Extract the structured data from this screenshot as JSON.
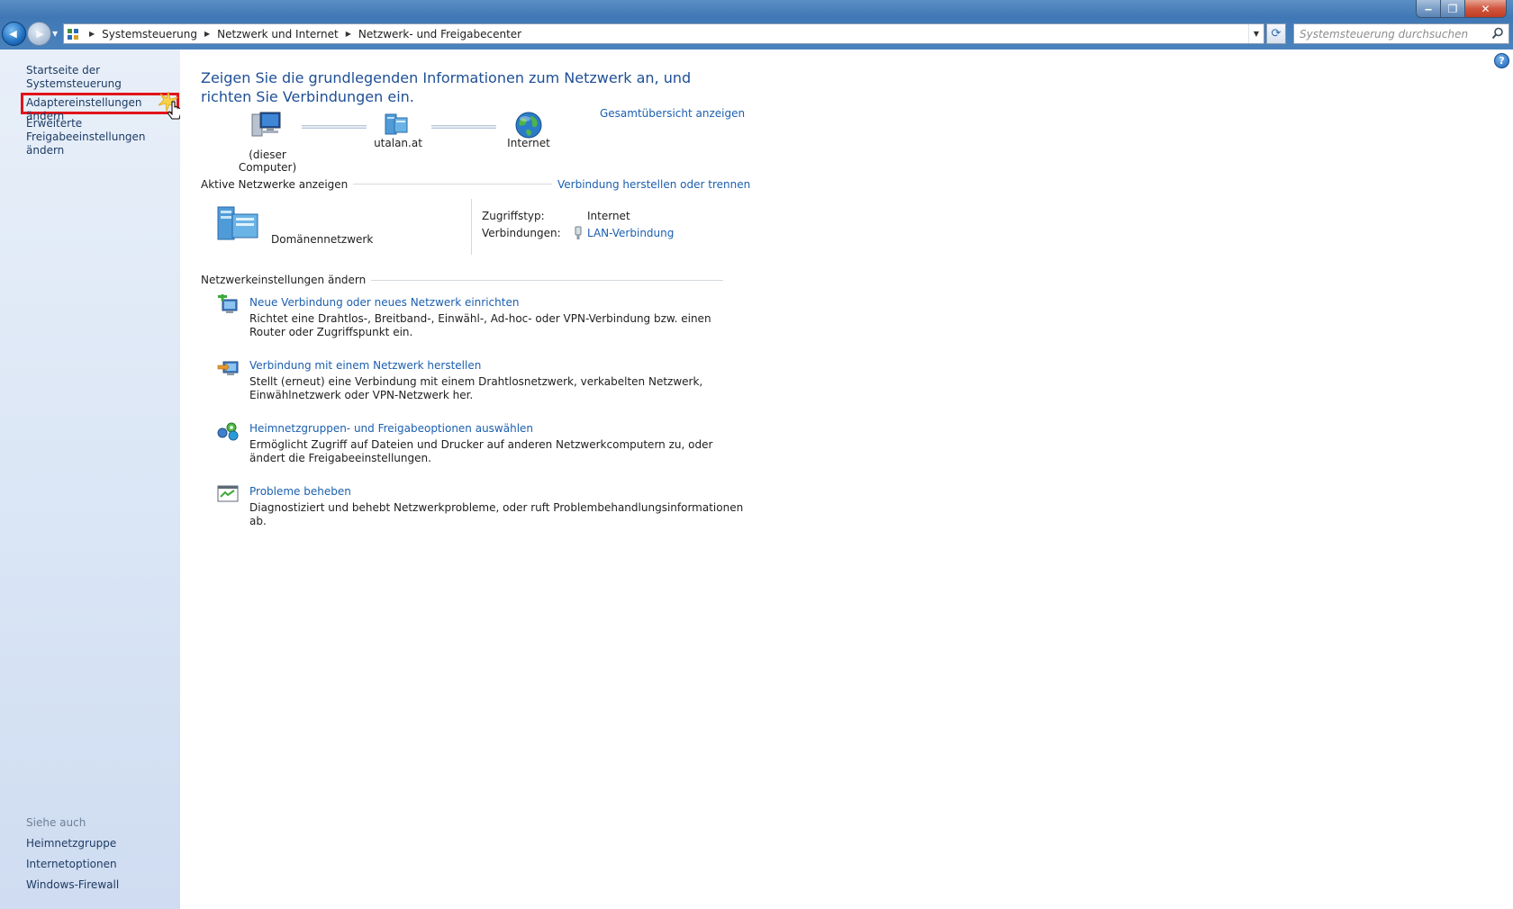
{
  "window": {
    "minimize_glyph": "‒",
    "maximize_glyph": "❐",
    "close_glyph": "✕"
  },
  "nav": {
    "back_glyph": "◀",
    "forward_glyph": "▶",
    "dropdown_glyph": "▼"
  },
  "address": {
    "breadcrumbs": [
      "Systemsteuerung",
      "Netzwerk und Internet",
      "Netzwerk- und Freigabecenter"
    ],
    "separator_glyph": "▶",
    "dropdown_glyph": "▼",
    "refresh_glyph": "⟳"
  },
  "search": {
    "placeholder": "Systemsteuerung durchsuchen"
  },
  "sidebar": {
    "items": [
      {
        "label": "Startseite der Systemsteuerung"
      },
      {
        "label": "Adaptereinstellungen ändern"
      },
      {
        "label_line1": "Erweiterte",
        "label_line2": "Freigabeeinstellungen ändern"
      }
    ],
    "see_also_title": "Siehe auch",
    "see_also": [
      {
        "label": "Heimnetzgruppe"
      },
      {
        "label": "Internetoptionen"
      },
      {
        "label": "Windows-Firewall"
      }
    ]
  },
  "main": {
    "help_glyph": "?",
    "heading": "Zeigen Sie die grundlegenden Informationen zum Netzwerk an, und richten Sie Verbindungen ein.",
    "map": {
      "computer_label": "(dieser Computer)",
      "network_label": "utalan.at",
      "internet_label": "Internet",
      "full_map_link": "Gesamtübersicht anzeigen"
    },
    "active_networks": {
      "title": "Aktive Netzwerke anzeigen",
      "connect_link": "Verbindung herstellen oder trennen",
      "network_name": "Domänennetzwerk",
      "access_type_label": "Zugriffstyp:",
      "access_type_value": "Internet",
      "connections_label": "Verbindungen:",
      "connections_value": "LAN-Verbindung"
    },
    "settings": {
      "title": "Netzwerkeinstellungen ändern",
      "tasks": [
        {
          "title": "Neue Verbindung oder neues Netzwerk einrichten",
          "desc": "Richtet eine Drahtlos-, Breitband-, Einwähl-, Ad-hoc- oder VPN-Verbindung bzw. einen Router oder Zugriffspunkt ein."
        },
        {
          "title": "Verbindung mit einem Netzwerk herstellen",
          "desc": "Stellt (erneut) eine Verbindung mit einem Drahtlosnetzwerk, verkabelten Netzwerk, Einwählnetzwerk oder VPN-Netzwerk her."
        },
        {
          "title": "Heimnetzgruppen- und Freigabeoptionen auswählen",
          "desc": "Ermöglicht Zugriff auf Dateien und Drucker auf anderen Netzwerkcomputern zu, oder ändert die Freigabeeinstellungen."
        },
        {
          "title": "Probleme beheben",
          "desc": "Diagnostiziert und behebt Netzwerkprobleme, oder ruft Problembehandlungsinformationen ab."
        }
      ]
    }
  },
  "colors": {
    "link": "#1b5fb0",
    "heading": "#1e4f96",
    "highlight": "#e0141a"
  }
}
